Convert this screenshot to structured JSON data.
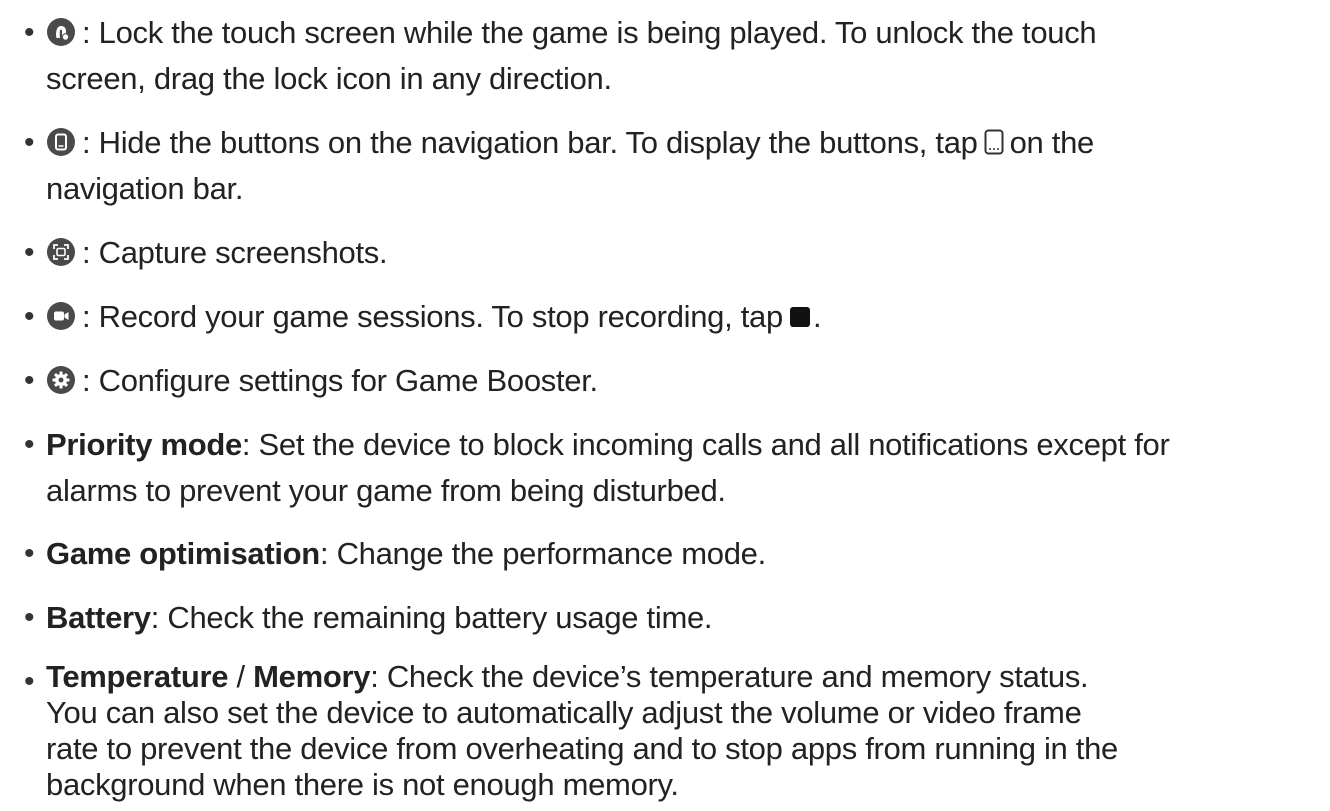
{
  "items": [
    {
      "icon": "lock-touch-icon",
      "lines": [
        ": Lock the touch screen while the game is being played. To unlock the touch",
        "screen, drag the lock icon in any direction."
      ]
    },
    {
      "icon": "hide-nav-buttons-icon",
      "line1_before": ": Hide the buttons on the navigation bar. To display the buttons, tap",
      "line1_after": "on the",
      "inline_icon": "navigation-bar-icon",
      "line2": "navigation bar."
    },
    {
      "icon": "screenshot-icon",
      "text": ": Capture screenshots."
    },
    {
      "icon": "record-icon",
      "text_before": ": Record your game sessions. To stop recording, tap",
      "inline_icon": "stop-icon",
      "text_after": "."
    },
    {
      "icon": "settings-gear-icon",
      "text": ": Configure settings for Game Booster."
    },
    {
      "term": "Priority mode",
      "lines": [
        ": Set the device to block incoming calls and all notifications except for",
        "alarms to prevent your game from being disturbed."
      ]
    },
    {
      "term": "Game optimisation",
      "text": ": Change the performance mode."
    },
    {
      "term": "Battery",
      "text": ": Check the remaining battery usage time."
    },
    {
      "term": "Temperature",
      "separator": " / ",
      "term2": "Memory",
      "lines": [
        ": Check the device’s temperature and memory status.",
        "You can also set the device to automatically adjust the volume or video frame",
        "rate to prevent the device from overheating and to stop apps from running in the",
        "background when there is not enough memory."
      ]
    }
  ],
  "bullet_char": "•",
  "colors": {
    "icon_bg": "#444444",
    "text": "#222222"
  }
}
